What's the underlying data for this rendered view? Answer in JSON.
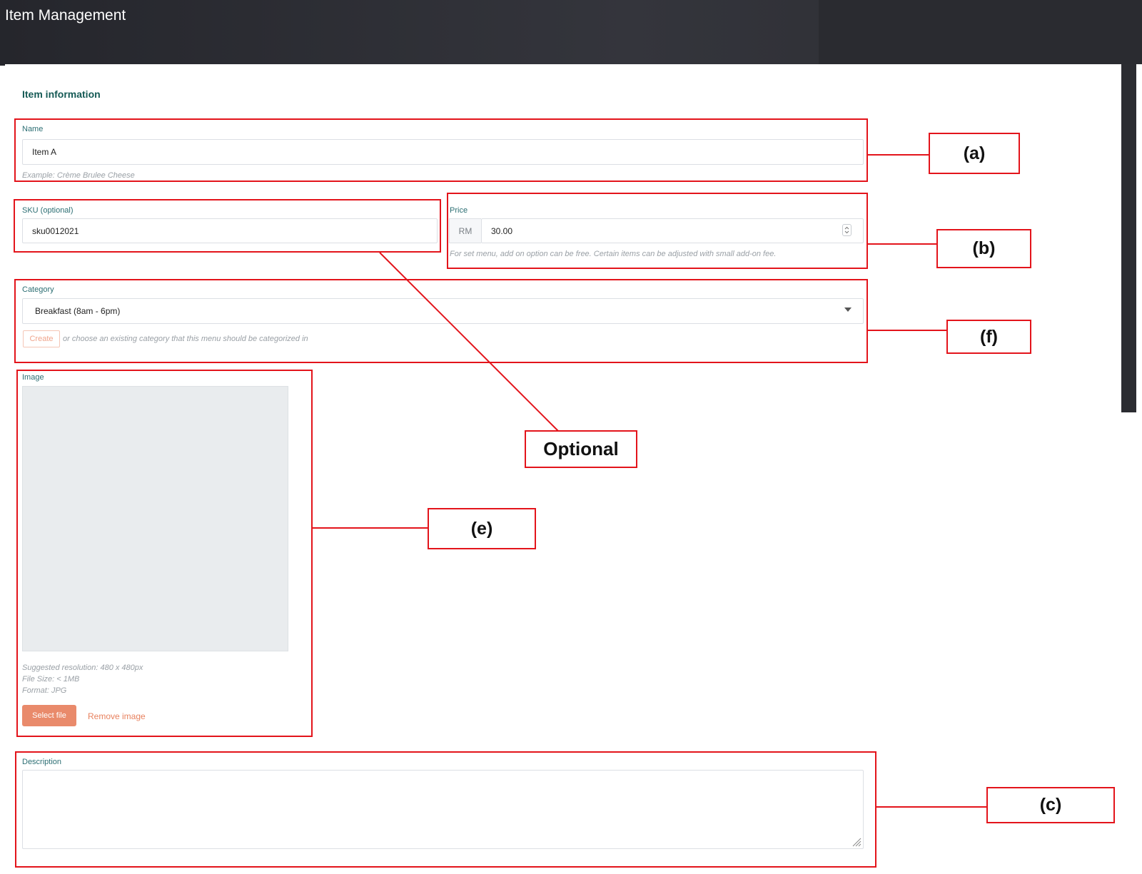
{
  "app": {
    "title": "Item Management"
  },
  "section": {
    "title": "Item information"
  },
  "name_field": {
    "label": "Name",
    "value": "Item A",
    "hint": "Example: Crème Brulee Cheese"
  },
  "sku_field": {
    "label": "SKU (optional)",
    "value": "sku0012021"
  },
  "price_field": {
    "label": "Price",
    "currency": "RM",
    "value": "30.00",
    "hint": "For set menu, add on option can be free. Certain items can be adjusted with small add-on fee."
  },
  "category_field": {
    "label": "Category",
    "selected": "Breakfast (8am - 6pm)",
    "create_label": "Create",
    "hint": "or choose an existing category that this menu should be categorized in"
  },
  "image_field": {
    "label": "Image",
    "info_lines": [
      "Suggested resolution: 480 x 480px",
      "File Size: < 1MB",
      "Format: JPG"
    ],
    "select_label": "Select file",
    "remove_label": "Remove image"
  },
  "description_field": {
    "label": "Description",
    "value": ""
  },
  "annotations": {
    "a": "(a)",
    "b": "(b)",
    "f": "(f)",
    "optional": "Optional",
    "e": "(e)",
    "c": "(c)"
  },
  "colors": {
    "annotation_red": "#e3141b",
    "label_teal": "#2c6e73",
    "accent_orange": "#e98a6b",
    "header_dark": "#2b2c31"
  }
}
